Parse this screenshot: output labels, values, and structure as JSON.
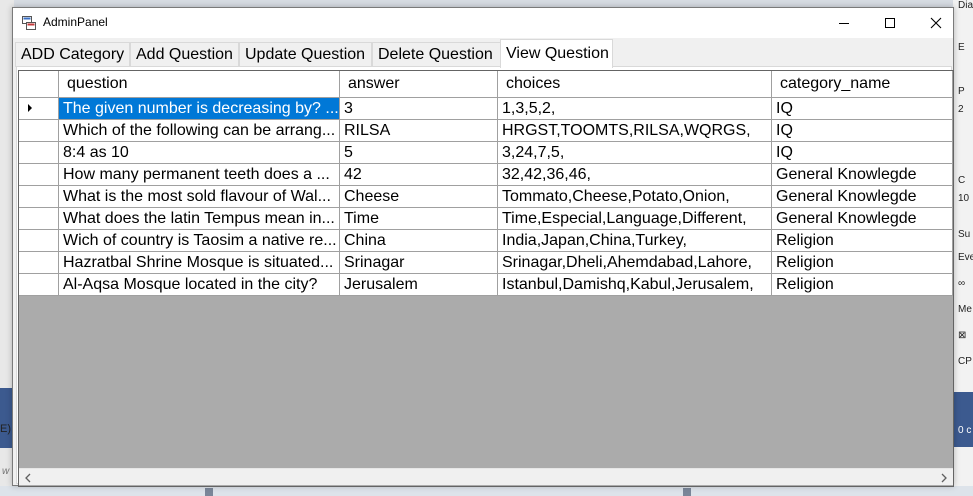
{
  "window": {
    "title": "AdminPanel"
  },
  "tabs": [
    {
      "label": "ADD Category"
    },
    {
      "label": "Add Question"
    },
    {
      "label": "Update Question"
    },
    {
      "label": "Delete Question"
    },
    {
      "label": "View Question",
      "active": true
    }
  ],
  "grid": {
    "columns": [
      "question",
      "answer",
      "choices",
      "category_name"
    ],
    "rows": [
      [
        "The given number is decreasing by? ...",
        "3",
        "1,3,5,2,",
        "IQ"
      ],
      [
        "Which of the following can be arrang...",
        "RILSA",
        "HRGST,TOOMTS,RILSA,WQRGS,",
        "IQ"
      ],
      [
        "8:4 as 10",
        "5",
        "3,24,7,5,",
        "IQ"
      ],
      [
        "How many permanent teeth does a ...",
        "42",
        "32,42,36,46,",
        "General Knowlegde"
      ],
      [
        "What is the most sold flavour of Wal...",
        "Cheese",
        "Tommato,Cheese,Potato,Onion,",
        "General Knowlegde"
      ],
      [
        "What does the latin Tempus mean in...",
        "Time",
        "Time,Especial,Language,Different,",
        "General Knowlegde"
      ],
      [
        "Wich of country is Taosim a native re...",
        "China",
        "India,Japan,China,Turkey,",
        "Religion"
      ],
      [
        "Hazratbal Shrine Mosque is situated...",
        "Srinagar",
        "Srinagar,Dheli,Ahemdabad,Lahore,",
        "Religion"
      ],
      [
        "Al-Aqsa Mosque located in the city?",
        "Jerusalem",
        "Istanbul,Damishq,Kabul,Jerusalem,",
        "Religion"
      ]
    ],
    "selected_row": 0,
    "selection_color": "#0078d7"
  },
  "background": {
    "right_labels": [
      "Dia",
      "E",
      "P",
      "2",
      "C",
      "10",
      "Su",
      "Eve",
      "∞",
      "Me",
      "⊠",
      "CP",
      "0 c"
    ],
    "left_labels": [
      "E)",
      "w"
    ]
  },
  "icons": {
    "minimize": "minimize-icon",
    "maximize": "maximize-icon",
    "close": "close-icon",
    "app": "app-icon",
    "row_indicator": "row-pointer-icon",
    "scroll_left": "chevron-left-icon",
    "scroll_right": "chevron-right-icon"
  }
}
